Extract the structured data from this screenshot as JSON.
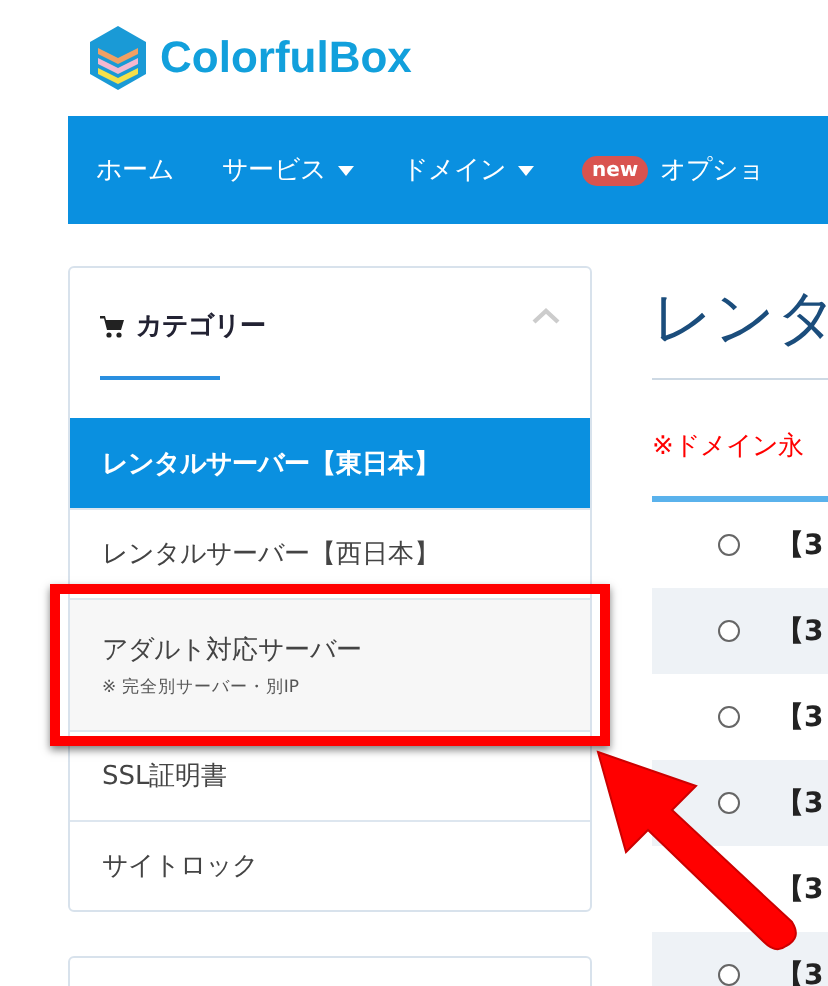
{
  "logo": {
    "text": "ColorfulBox"
  },
  "nav": [
    {
      "label": "ホーム",
      "caret": false
    },
    {
      "label": "サービス",
      "caret": true
    },
    {
      "label": "ドメイン",
      "caret": true
    },
    {
      "label": "オプショ",
      "caret": false,
      "badge": "new"
    }
  ],
  "sidebar": {
    "title": "カテゴリー",
    "items": [
      {
        "label": "レンタルサーバー【東日本】",
        "selected": true
      },
      {
        "label": "レンタルサーバー【西日本】",
        "selected": false
      },
      {
        "label": "アダルト対応サーバー",
        "note": "※ 完全別サーバー・別IP",
        "selected": false,
        "highlighted": true
      },
      {
        "label": "SSL証明書",
        "selected": false
      },
      {
        "label": "サイトロック",
        "selected": false
      }
    ]
  },
  "main": {
    "heading": "レンタ",
    "notice": "※ドメイン永",
    "rows": [
      {
        "text": "【3",
        "selected": false
      },
      {
        "text": "【3",
        "selected": false
      },
      {
        "text": "【3",
        "selected": false
      },
      {
        "text": "【3",
        "selected": false
      },
      {
        "text": "【3"
      },
      {
        "text": "【3",
        "selected": false
      }
    ]
  }
}
